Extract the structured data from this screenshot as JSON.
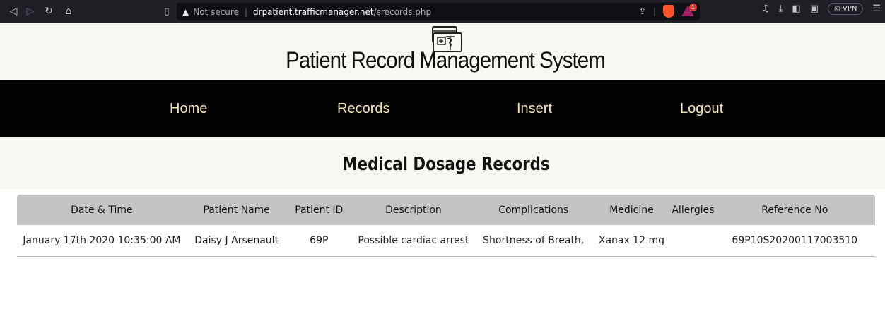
{
  "browser": {
    "url_warning": "Not secure",
    "url_host": "drpatient.trafficmanager.net",
    "url_path": "/srecords.php",
    "vpn_label": "VPN",
    "rewards_badge": "1"
  },
  "site": {
    "title": "Patient Record Management System"
  },
  "nav": {
    "home": "Home",
    "records": "Records",
    "insert": "Insert",
    "logout": "Logout"
  },
  "page": {
    "heading": "Medical Dosage Records"
  },
  "table": {
    "columns": [
      "Date & Time",
      "Patient Name",
      "Patient ID",
      "Description",
      "Complications",
      "Medicine",
      "Allergies",
      "Reference No"
    ],
    "rows": [
      [
        "January 17th 2020 10:35:00 AM",
        "Daisy J Arsenault",
        "69P",
        "Possible cardiac arrest",
        "Shortness of Breath,",
        "Xanax 12 mg",
        "",
        "69P10S20200117003510"
      ]
    ]
  },
  "colors": {
    "nav_bg": "#000000",
    "nav_text": "#f3e3b9",
    "header_bg": "#f8f8f2",
    "table_header_bg": "#c4c4c4"
  }
}
